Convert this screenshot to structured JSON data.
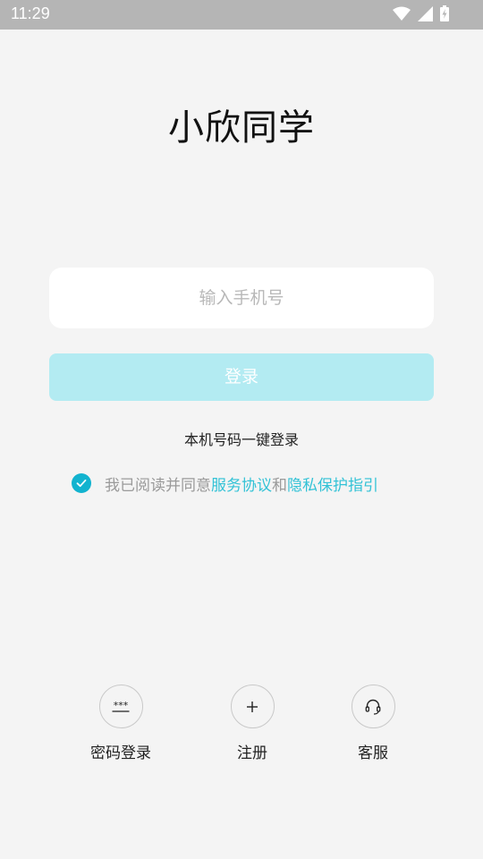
{
  "status_bar": {
    "time": "11:29",
    "icons": [
      "wifi-icon",
      "signal-icon",
      "battery-charging-icon"
    ]
  },
  "app_title": "小欣同学",
  "phone_input": {
    "placeholder": "输入手机号",
    "value": ""
  },
  "login_button": {
    "label": "登录",
    "color": "#b3ebf2"
  },
  "onekey_login_label": "本机号码一键登录",
  "agreement": {
    "checked": true,
    "prefix": "我已阅读并同意",
    "service_link": "服务协议",
    "conjunction": "和",
    "privacy_link": "隐私保护指引",
    "link_color": "#32c2d6"
  },
  "bottom_actions": [
    {
      "label": "密码登录",
      "icon": "password-icon"
    },
    {
      "label": "注册",
      "icon": "plus-icon"
    },
    {
      "label": "客服",
      "icon": "headset-icon"
    }
  ]
}
